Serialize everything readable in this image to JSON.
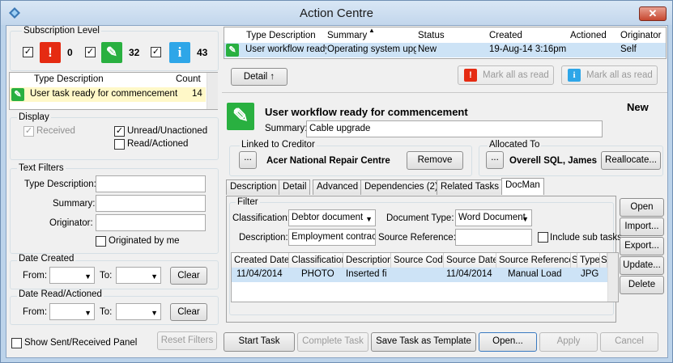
{
  "window": {
    "title": "Action Centre",
    "close_glyph": "✕"
  },
  "subscription": {
    "legend": "Subscription Level",
    "items": [
      {
        "icon": "exclamation-icon",
        "glyph": "!",
        "count": "0",
        "checked": "✓"
      },
      {
        "icon": "pencil-icon",
        "glyph": "✎",
        "count": "32",
        "checked": "✓"
      },
      {
        "icon": "info-icon",
        "glyph": "i",
        "count": "43",
        "checked": "✓"
      }
    ]
  },
  "type_list": {
    "headers": [
      "Type Description",
      "Count"
    ],
    "rows": [
      {
        "icon": "pencil-icon",
        "glyph": "✎",
        "description": "User task ready for commencement",
        "count": "14"
      }
    ]
  },
  "display": {
    "legend": "Display",
    "received": "Received",
    "unread": "Unread/Unactioned",
    "read": "Read/Actioned",
    "check": "✓"
  },
  "text_filters": {
    "legend": "Text Filters",
    "type_description_label": "Type Description:",
    "summary_label": "Summary:",
    "originator_label": "Originator:",
    "type_description_value": "",
    "summary_value": "",
    "originator_value": "",
    "originated_by_me": "Originated by me"
  },
  "date_created": {
    "legend": "Date Created",
    "from": "From:",
    "to": "To:",
    "clear": "Clear"
  },
  "date_read": {
    "legend": "Date Read/Actioned",
    "from": "From:",
    "to": "To:",
    "clear": "Clear"
  },
  "bottom_left": {
    "show_panel": "Show Sent/Received Panel",
    "reset": "Reset Filters"
  },
  "messages": {
    "headers": [
      "Type Description",
      "Summary",
      "Status",
      "Created",
      "Actioned",
      "Originator"
    ],
    "sort_glyph": "▲",
    "rows": [
      {
        "type": "User workflow ready",
        "summary": "Operating system upgr",
        "status": "New",
        "created": "19-Aug-14 3:16pm",
        "actioned": "",
        "originator": "Self"
      }
    ]
  },
  "toolbar": {
    "detail": "Detail ↑",
    "mark_urgent": "Mark all as read",
    "mark_info": "Mark all as read"
  },
  "detail": {
    "title": "User workflow ready for commencement",
    "status": "New",
    "summary_label": "Summary:",
    "summary_value": "Cable upgrade",
    "linked_legend": "Linked to Creditor",
    "ellipsis": "...",
    "creditor": "Acer National Repair Centre",
    "remove": "Remove",
    "allocated_legend": "Allocated To",
    "allocated": "Overell SQL, James",
    "reallocate": "Reallocate..."
  },
  "tabs": [
    "Description",
    "Detail",
    "Advanced",
    "Dependencies (2)",
    "Related Tasks",
    "DocMan"
  ],
  "docman": {
    "filter_legend": "Filter",
    "classification_label": "Classification:",
    "classification_value": "Debtor document",
    "doctype_label": "Document Type:",
    "doctype_value": "Word Document",
    "description_label": "Description:",
    "description_value": "Employment contract",
    "source_ref_label": "Source Reference:",
    "source_ref_value": "",
    "include_sub": "Include sub tasks",
    "headers": [
      "Created Date",
      "Classification",
      "Description",
      "Source Code",
      "Source Date",
      "Source Reference",
      "S",
      "Type",
      "S"
    ],
    "rows": [
      {
        "created": "11/04/2014",
        "classification": "PHOTO",
        "description": "Inserted fi",
        "source_code": "",
        "source_date": "11/04/2014",
        "source_ref": "Manual Load",
        "s1": "",
        "type": "JPG",
        "s2": ""
      }
    ],
    "buttons": [
      "Open",
      "Import...",
      "Export...",
      "Update...",
      "Delete"
    ]
  },
  "actions": [
    "Start Task",
    "Complete Task",
    "Save Task as Template",
    "Open...",
    "Apply",
    "Cancel"
  ],
  "colors": {
    "urgent": "#e52b12",
    "task": "#29b040",
    "info": "#2ea6e8",
    "selected_row": "#cde3f6"
  }
}
